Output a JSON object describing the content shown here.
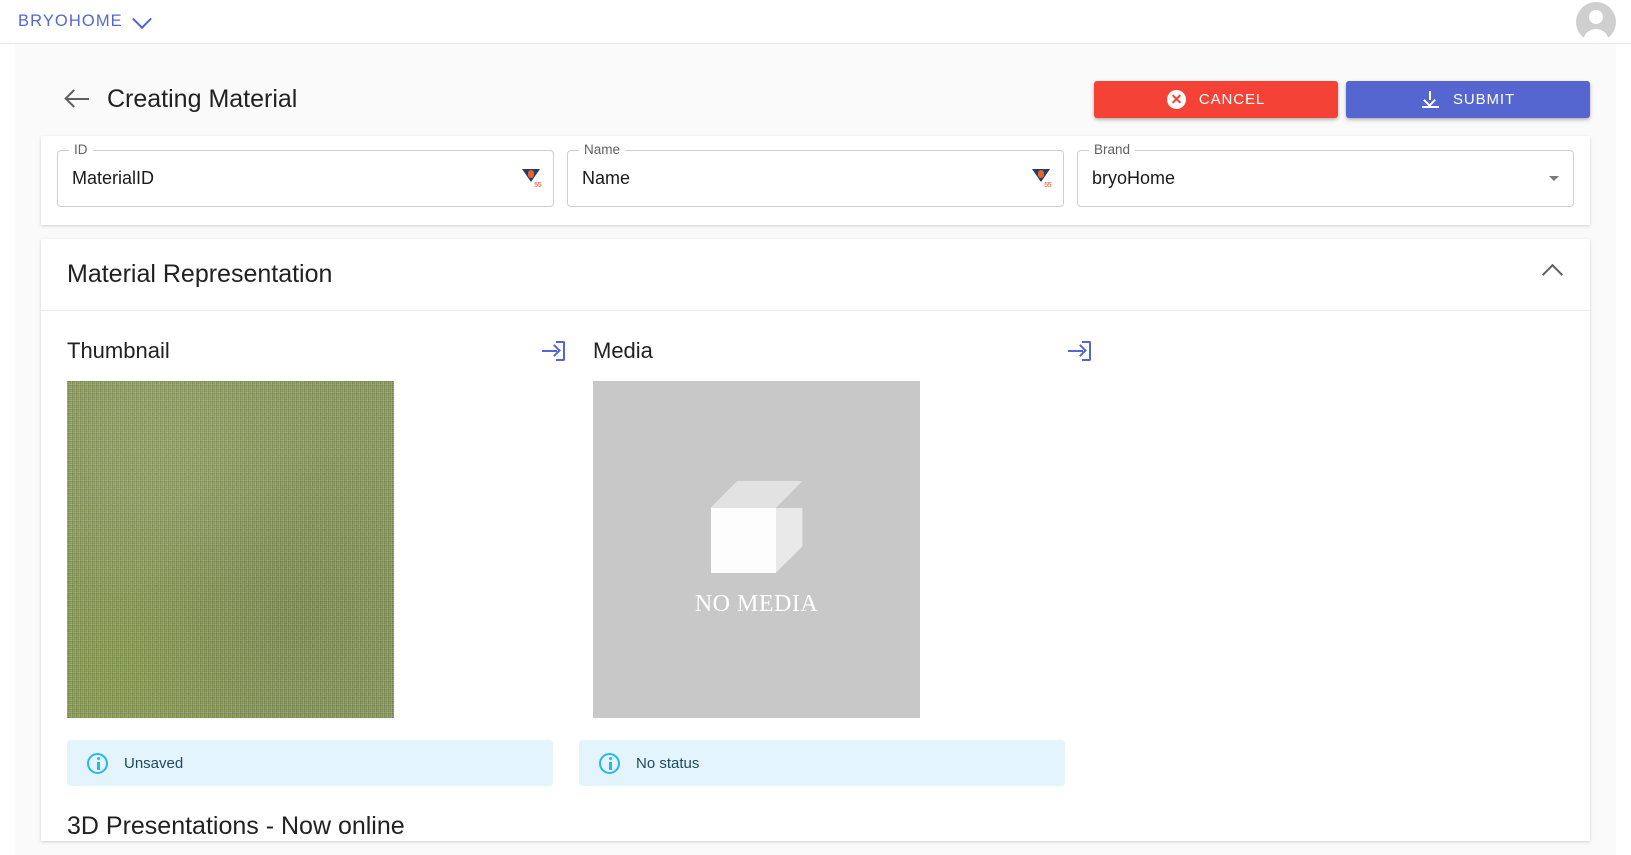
{
  "appbar": {
    "brand_label": "BRYOHOME",
    "brand_caret_icon": "chevron-down-icon",
    "avatar_icon": "account-circle-icon"
  },
  "header": {
    "back_icon": "arrow-left-icon",
    "title": "Creating Material",
    "cancel_label": "CANCEL",
    "cancel_icon": "cancel-circle-icon",
    "cancel_color": "#F44336",
    "submit_label": "SUBMIT",
    "submit_icon": "download-icon",
    "submit_color": "#5566D0"
  },
  "form": {
    "fields": [
      {
        "legend": "ID",
        "value": "MaterialID",
        "badge_icon": "locale-flag-badge",
        "badge_number": "55"
      },
      {
        "legend": "Name",
        "value": "Name",
        "badge_icon": "locale-flag-badge",
        "badge_number": "55"
      },
      {
        "legend": "Brand",
        "value": "bryoHome",
        "dropdown_icon": "select-arrow-icon"
      }
    ]
  },
  "section": {
    "title": "Material Representation",
    "collapse_icon": "chevron-up-icon",
    "assets": [
      {
        "title": "Thumbnail",
        "import_icon": "import-arrow-icon",
        "preview_type": "image",
        "preview_color": "#8D9A62",
        "status_icon": "info-icon",
        "status_text": "Unsaved"
      },
      {
        "title": "Media",
        "import_icon": "import-arrow-icon",
        "preview_type": "placeholder",
        "placeholder_icon": "cube-3d-icon",
        "placeholder_text": "NO MEDIA",
        "status_icon": "info-icon",
        "status_text": "No status"
      }
    ],
    "subsection_title": "3D Presentations - Now online"
  }
}
